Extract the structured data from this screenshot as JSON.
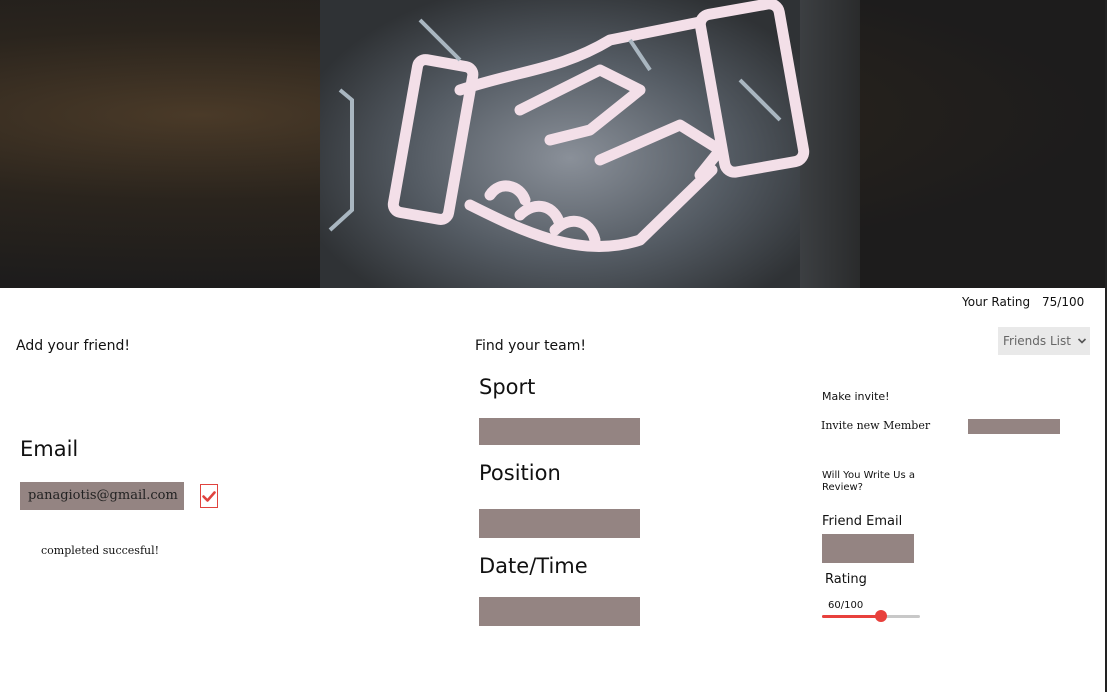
{
  "rating": {
    "label": "Your Rating",
    "value": "75/100"
  },
  "left": {
    "title": "Add your friend!",
    "email_label": "Email",
    "email_value": "panagiotis@gmail.com",
    "status": "completed succesful!"
  },
  "middle": {
    "title": "Find your team!",
    "sport_label": "Sport",
    "position_label": "Position",
    "datetime_label": "Date/Time"
  },
  "right": {
    "dropdown_label": "Friends List",
    "make_invite": "Make invite!",
    "invite_label": "Invite new Member",
    "review_prompt_1": "Will You Write Us a",
    "review_prompt_2": "Review?",
    "friend_email_label": "Friend Email",
    "rating_label": "Rating",
    "rating_value": "60/100",
    "rating_fraction": 0.6
  },
  "colors": {
    "accent": "#e8403c",
    "input_fill": "#948482"
  }
}
